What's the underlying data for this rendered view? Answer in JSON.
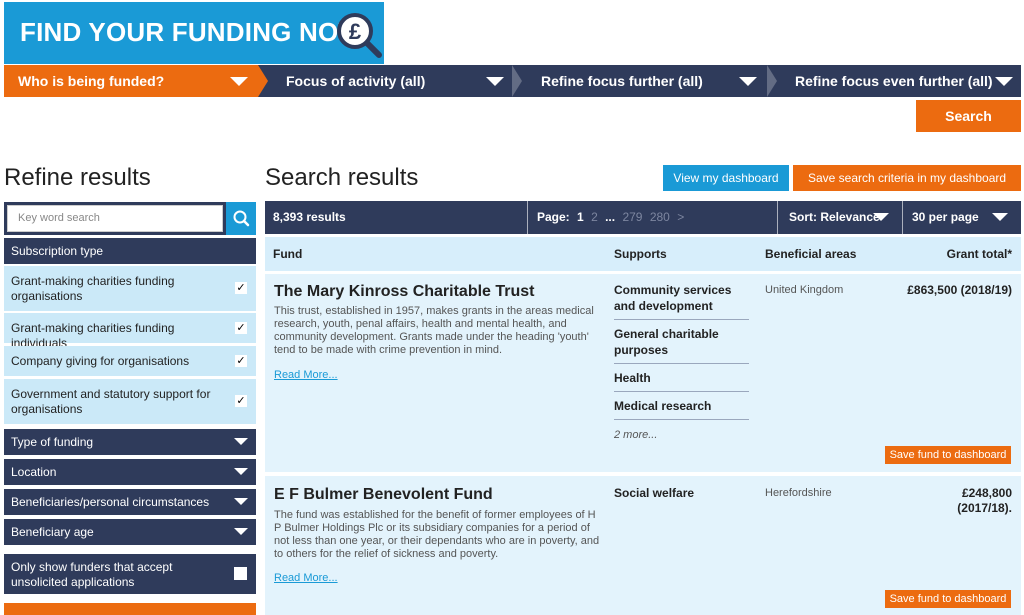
{
  "banner": {
    "title": "FIND YOUR FUNDING NOW",
    "icon": "pound-magnifier-icon"
  },
  "steps": [
    {
      "label": "Who is being funded?"
    },
    {
      "label": "Focus of activity (all)"
    },
    {
      "label": "Refine focus further (all)"
    },
    {
      "label": "Refine focus even further (all)"
    }
  ],
  "search_button": "Search",
  "refine": {
    "title": "Refine results",
    "keyword_placeholder": "Key word search",
    "subscription_heading": "Subscription type",
    "subscription_options": [
      {
        "label": "Grant-making charities funding organisations",
        "checked": "✓"
      },
      {
        "label": "Grant-making charities funding individuals",
        "checked": "✓"
      },
      {
        "label": "Company giving for organisations",
        "checked": "✓"
      },
      {
        "label": "Government and statutory support for organisations",
        "checked": "✓"
      }
    ],
    "filters": [
      "Type of funding",
      "Location",
      "Beneficiaries/personal circumstances",
      "Beneficiary age"
    ],
    "unsolicited": "Only show funders that accept unsolicited applications"
  },
  "results": {
    "title": "Search results",
    "dashboard_button": "View my dashboard",
    "save_criteria_button": "Save search criteria in my dashboard",
    "count": "8,393 results",
    "page_label": "Page:",
    "pages": [
      "1",
      "2",
      "...",
      "279",
      "280",
      ">"
    ],
    "sort": "Sort: Relevance",
    "per_page": "30 per page",
    "columns": {
      "fund": "Fund",
      "supports": "Supports",
      "areas": "Beneficial areas",
      "total": "Grant total*"
    },
    "save_fund_label": "Save fund to dashboard",
    "read_more": "Read More...",
    "funds": [
      {
        "name": "The Mary Kinross Charitable Trust",
        "description": "This trust, established in 1957, makes grants in the areas medical research, youth, penal affairs, health and mental health, and community development. Grants made under the heading 'youth' tend to be made with crime prevention in mind.",
        "supports": [
          "Community services and development",
          "General charitable purposes",
          "Health",
          "Medical research"
        ],
        "supports_more": "2 more...",
        "area": "United Kingdom",
        "total": "£863,500 (2018/19)"
      },
      {
        "name": "E F Bulmer Benevolent Fund",
        "description": "The fund was established for the benefit of former employees of H P Bulmer Holdings Plc or its subsidiary companies for a period of not less than one year, or their dependants who are in poverty, and to others for the relief of sickness and poverty.",
        "supports": [
          "Social welfare"
        ],
        "area": "Herefordshire",
        "total_line1": "£248,800",
        "total_line2": "(2017/18)."
      }
    ]
  },
  "colors": {
    "navy": "#2f3b5b",
    "orange": "#ec6b10",
    "blue": "#1a9ad6",
    "light_blue": "#cbe9f8"
  }
}
